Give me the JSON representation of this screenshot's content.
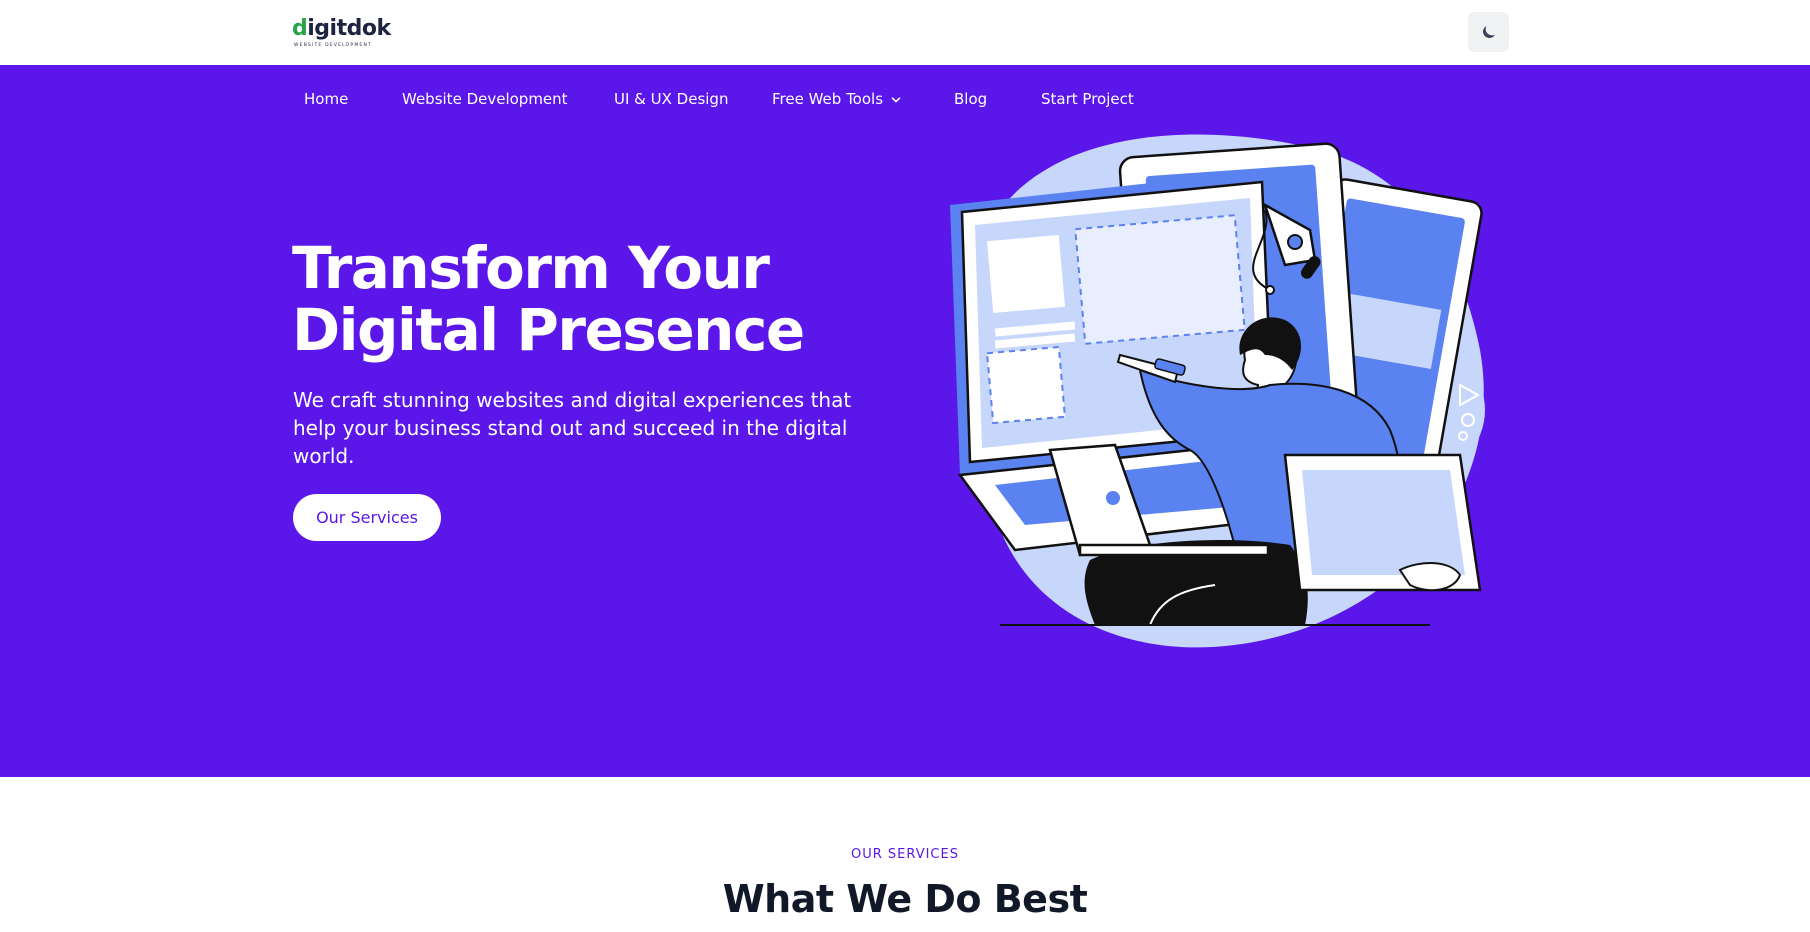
{
  "header": {
    "logo_text_d": "d",
    "logo_text_rest": "igitdok",
    "logo_tagline": "WEBSITE DEVELOPMENT",
    "theme_toggle_icon": "moon-icon"
  },
  "nav": {
    "items": [
      {
        "label": "Home"
      },
      {
        "label": "Website Development"
      },
      {
        "label": "UI & UX Design"
      },
      {
        "label": "Free Web Tools",
        "dropdown_icon": "chevron-down-icon"
      },
      {
        "label": "Blog"
      },
      {
        "label": "Start Project"
      }
    ]
  },
  "hero": {
    "title_line1": "Transform Your",
    "title_line2": "Digital Presence",
    "subtitle": "We craft stunning websites and digital experiences that help your business stand out and succeed in the digital world.",
    "cta_label": "Our Services"
  },
  "services": {
    "eyebrow": "OUR SERVICES",
    "heading": "What We Do Best"
  },
  "colors": {
    "brand_purple": "#5b16ea",
    "illustration_blue": "#5a82f0",
    "illustration_light": "#c7d6fb",
    "logo_green": "#2aa44a",
    "logo_dark": "#1d2340",
    "heading_dark": "#111827"
  }
}
